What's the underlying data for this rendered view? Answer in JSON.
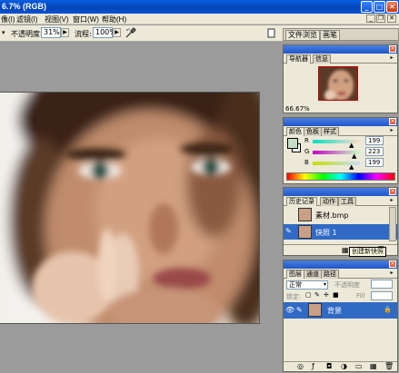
{
  "window": {
    "title": "6.7% (RGB)",
    "minimize_glyph": "_",
    "maximize_glyph": "□",
    "close_glyph": "✕"
  },
  "menu": {
    "items": [
      "像(I)",
      "滤镜(I)",
      "视图(V)",
      "窗口(W)",
      "帮助(H)"
    ],
    "mdi_min": "_",
    "mdi_restore": "❐",
    "mdi_close": "✕"
  },
  "options": {
    "opacity_label": "不透明度:",
    "opacity_value": "31%",
    "flow_label": "流程:",
    "flow_value": "100%"
  },
  "palette_well": {
    "tab1": "文件浏览",
    "tab2": "画笔"
  },
  "navigator": {
    "tab_navigator": "导航器",
    "tab_info": "信息",
    "zoom": "66.67%"
  },
  "color_panel": {
    "tab_color": "颜色",
    "tab_swatches": "色板",
    "tab_styles": "样式",
    "r_label": "R",
    "g_label": "G",
    "b_label": "B",
    "r_value": "199",
    "g_value": "223",
    "b_value": "199"
  },
  "history": {
    "tab_history": "历史记录",
    "tab_actions": "动作",
    "tab_tools": "工具",
    "items": [
      "素材.bmp",
      "快照 1"
    ]
  },
  "tooltip": "创建新快照",
  "layers": {
    "tab_layers": "图层",
    "tab_channels": "通道",
    "tab_paths": "路径",
    "blend_mode": "正常",
    "opacity_label": "不透明度",
    "lock_label": "锁定:",
    "fill_label": "Fill",
    "layer_name": "背景"
  },
  "colors": {
    "titlebar": "#0a5ee0",
    "selection": "#316ac5",
    "panel_bg": "#ece9d8",
    "workspace": "#9b9b9b"
  }
}
